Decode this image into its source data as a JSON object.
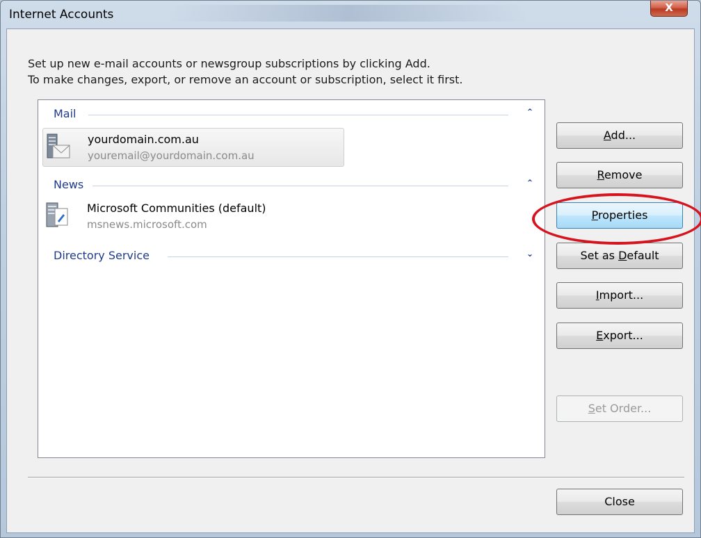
{
  "window": {
    "title": "Internet Accounts",
    "close_glyph": "X"
  },
  "instructions": {
    "line1": "Set up new e-mail accounts or newsgroup subscriptions by clicking Add.",
    "line2": "To make changes, export, or remove an account or subscription, select it first."
  },
  "groups": [
    {
      "label": "Mail",
      "expanded": true,
      "items": [
        {
          "name": "yourdomain.com.au",
          "sub": "youremail@yourdomain.com.au",
          "icon": "mail-account-icon"
        }
      ]
    },
    {
      "label": "News",
      "expanded": true,
      "items": [
        {
          "name": "Microsoft Communities (default)",
          "sub": "msnews.microsoft.com",
          "icon": "news-server-icon"
        }
      ]
    },
    {
      "label": "Directory Service",
      "expanded": false,
      "items": []
    }
  ],
  "buttons": {
    "add": {
      "pre": "",
      "acc": "A",
      "post": "dd..."
    },
    "remove": {
      "pre": "",
      "acc": "R",
      "post": "emove"
    },
    "properties": {
      "pre": "",
      "acc": "P",
      "post": "roperties"
    },
    "set_default": {
      "pre": "Set as ",
      "acc": "D",
      "post": "efault"
    },
    "import": {
      "pre": "",
      "acc": "I",
      "post": "mport..."
    },
    "export": {
      "pre": "",
      "acc": "E",
      "post": "xport..."
    },
    "set_order": {
      "pre": "",
      "acc": "S",
      "post": "et Order..."
    },
    "close": {
      "label": "Close"
    }
  },
  "colors": {
    "group_header": "#1e3a8a",
    "highlight_oval": "#d6141e"
  }
}
